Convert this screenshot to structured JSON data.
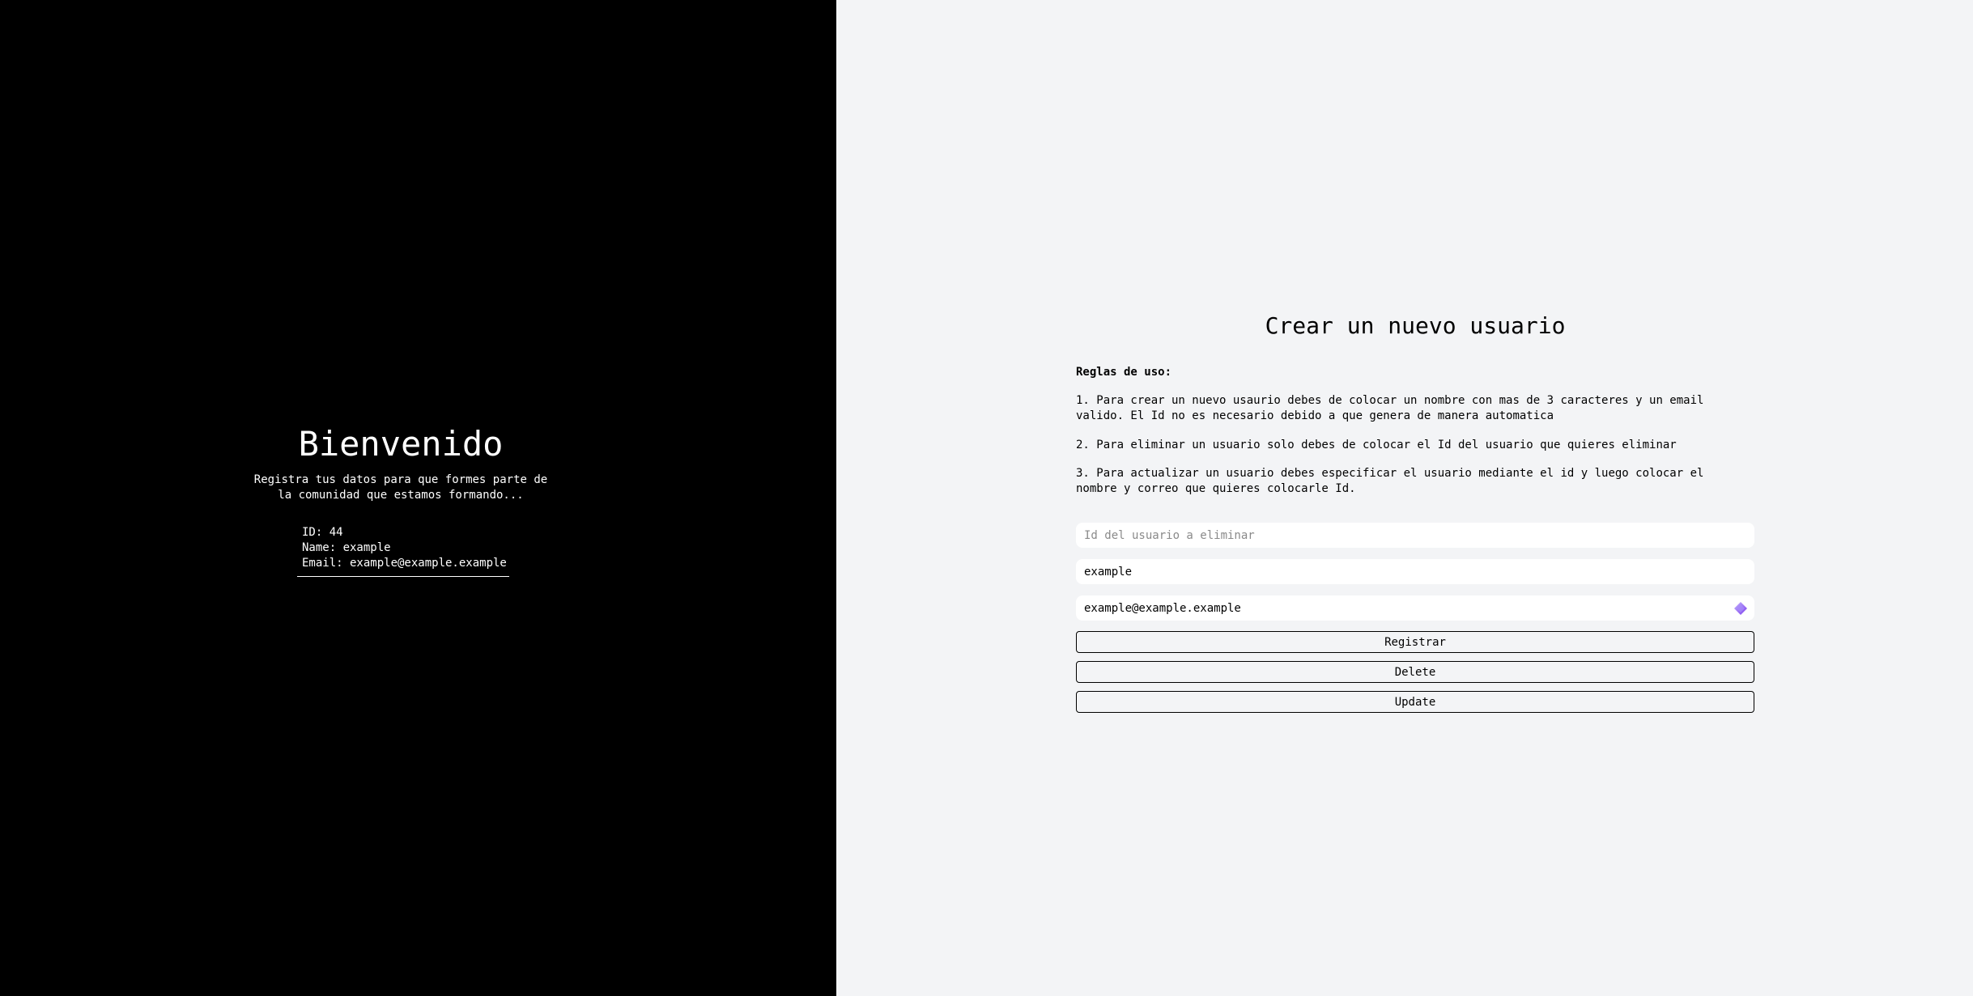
{
  "welcome": {
    "title": "Bienvenido",
    "subtitle": "Registra tus datos para que formes parte de la comunidad que estamos formando..."
  },
  "user": {
    "id_line": "ID: 44",
    "name_line": "Name: example",
    "email_line": "Email: example@example.example"
  },
  "form": {
    "title": "Crear un nuevo usuario",
    "rules_heading": "Reglas de uso:",
    "rules": [
      "1. Para crear un nuevo usaurio debes de colocar un nombre con mas de 3 caracteres y un email valido. El Id no es necesario debido a que genera de manera automatica",
      "2. Para eliminar un usuario solo debes de colocar el Id del usuario que quieres eliminar",
      "3. Para actualizar un usuario debes especificar el usuario mediante el id y luego colocar el nombre y correo que quieres colocarle Id."
    ],
    "id_field": {
      "placeholder": "Id del usuario a eliminar",
      "value": ""
    },
    "name_field": {
      "placeholder": "",
      "value": "example"
    },
    "email_field": {
      "placeholder": "",
      "value": "example@example.example"
    },
    "buttons": {
      "register": "Registrar",
      "delete": "Delete",
      "update": "Update"
    }
  },
  "icons": {
    "email_field_icon": "password-manager-icon"
  },
  "colors": {
    "left_background": "#000000",
    "right_background": "#f3f4f6",
    "icon_accent": "#8b5cf6"
  }
}
